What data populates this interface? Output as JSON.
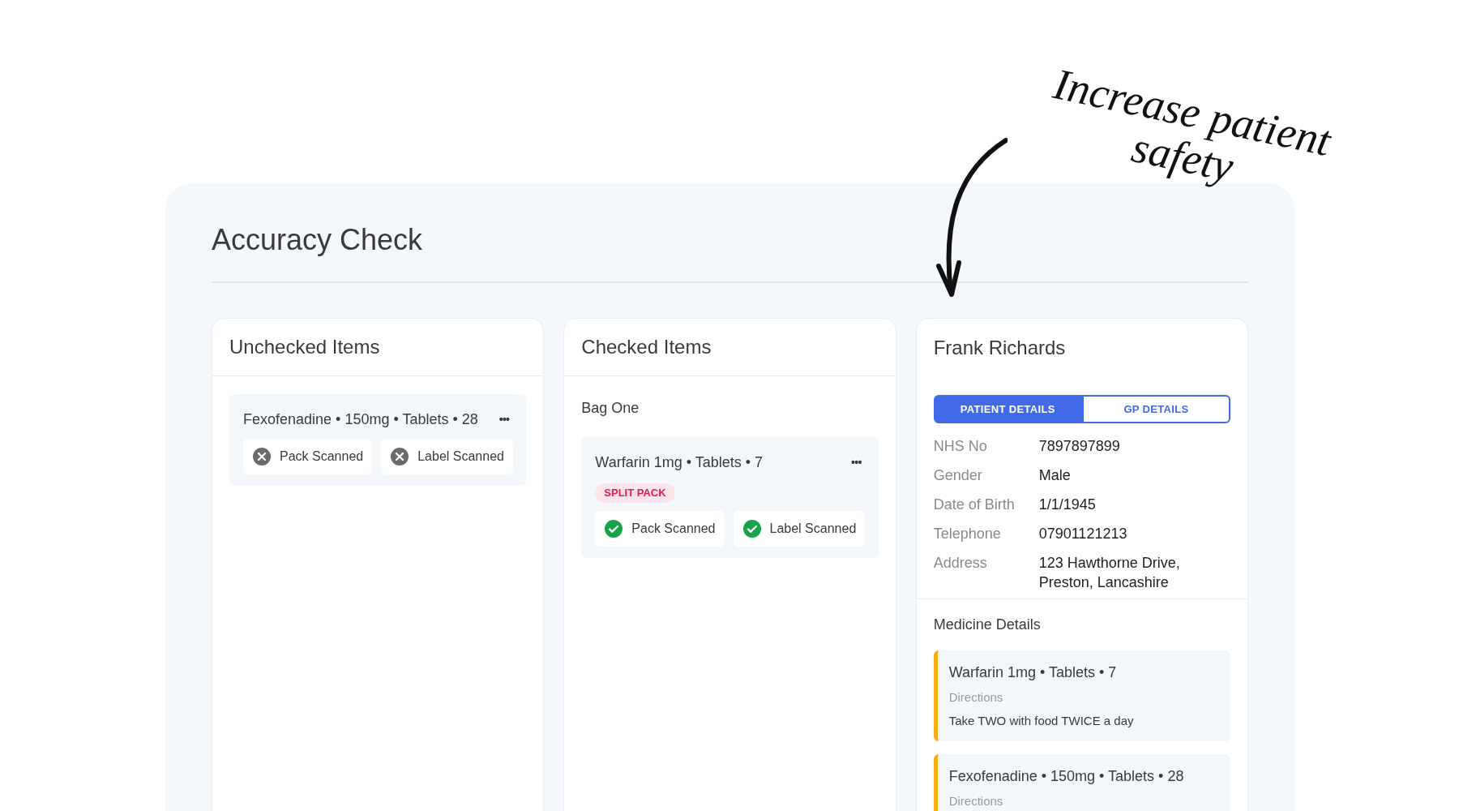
{
  "annotation": {
    "text": "Increase patient safety"
  },
  "page": {
    "title": "Accuracy Check"
  },
  "unchecked": {
    "title": "Unchecked Items",
    "items": [
      {
        "name": "Fexofenadine • 150mg • Tablets • 28",
        "menu": "•••",
        "checks": [
          {
            "label": "Pack Scanned",
            "checked": false
          },
          {
            "label": "Label Scanned",
            "checked": false
          }
        ]
      }
    ]
  },
  "checked": {
    "title": "Checked Items",
    "bag": "Bag One",
    "items": [
      {
        "name": "Warfarin 1mg • Tablets • 7",
        "menu": "•••",
        "tag": "SPLIT PACK",
        "checks": [
          {
            "label": "Pack Scanned",
            "checked": true
          },
          {
            "label": "Label Scanned",
            "checked": true
          }
        ]
      }
    ]
  },
  "patient": {
    "name": "Frank Richards",
    "tabs": [
      {
        "label": "PATIENT DETAILS",
        "selected": true
      },
      {
        "label": "GP DETAILS",
        "selected": false
      }
    ],
    "fields": [
      {
        "label": "NHS No",
        "value": "7897897899"
      },
      {
        "label": "Gender",
        "value": "Male"
      },
      {
        "label": "Date of Birth",
        "value": "1/1/1945"
      },
      {
        "label": "Telephone",
        "value": "07901121213"
      },
      {
        "label": "Address",
        "value": "123 Hawthorne Drive, Preston, Lancashire"
      }
    ],
    "medicine_title": "Medicine Details",
    "medicines": [
      {
        "name": "Warfarin 1mg • Tablets • 7",
        "directions_label": "Directions",
        "directions": "Take TWO with food TWICE a day"
      },
      {
        "name": "Fexofenadine • 150mg • Tablets • 28",
        "directions_label": "Directions"
      }
    ]
  }
}
